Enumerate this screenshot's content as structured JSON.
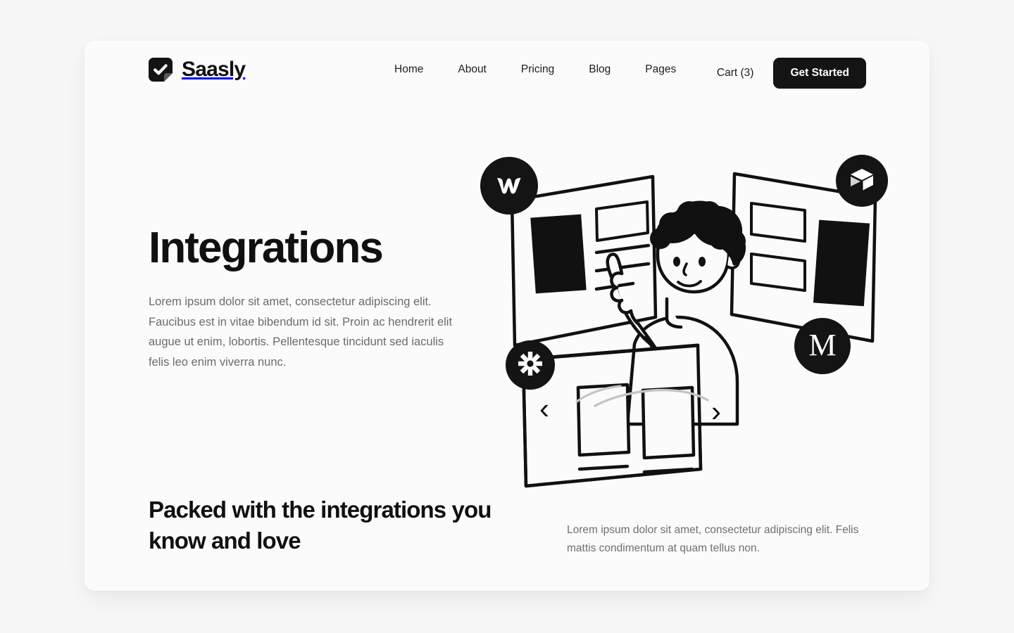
{
  "brand": {
    "name": "Saasly",
    "logo_icon": "checkmark-square-icon"
  },
  "nav": {
    "items": [
      {
        "label": "Home"
      },
      {
        "label": "About"
      },
      {
        "label": "Pricing"
      },
      {
        "label": "Blog"
      },
      {
        "label": "Pages"
      }
    ],
    "cart_label": "Cart (3)",
    "cta_label": "Get Started"
  },
  "hero": {
    "title": "Integrations",
    "description": "Lorem ipsum dolor sit amet, consectetur adipiscing elit. Faucibus est in vitae bibendum id sit. Proin ac hendrerit elit augue ut enim, lobortis. Pellentesque tincidunt sed iaculis felis leo enim viverra nunc."
  },
  "integration_badges": [
    {
      "name": "webflow",
      "icon": "webflow-w-icon",
      "label": "Webflow"
    },
    {
      "name": "box",
      "icon": "cube-box-icon",
      "label": "Box"
    },
    {
      "name": "asterisk",
      "icon": "asterisk-icon",
      "label": "Asterisk"
    },
    {
      "name": "medium",
      "icon": "medium-m-icon",
      "label": "M"
    }
  ],
  "illustration": {
    "alt": "person pointing at floating ui panels",
    "carousel_prev": "‹",
    "carousel_next": "›"
  },
  "bottom": {
    "heading": "Packed with the integrations you know and love",
    "description": "Lorem ipsum dolor sit amet, consectetur adipiscing elit. Felis mattis condimentum at quam tellus non."
  },
  "colors": {
    "page_background": "#f7f7f7",
    "card_background": "#fbfbfb",
    "ink": "#101010",
    "muted_text": "#6b6b6b",
    "accent_dark": "#141414"
  }
}
